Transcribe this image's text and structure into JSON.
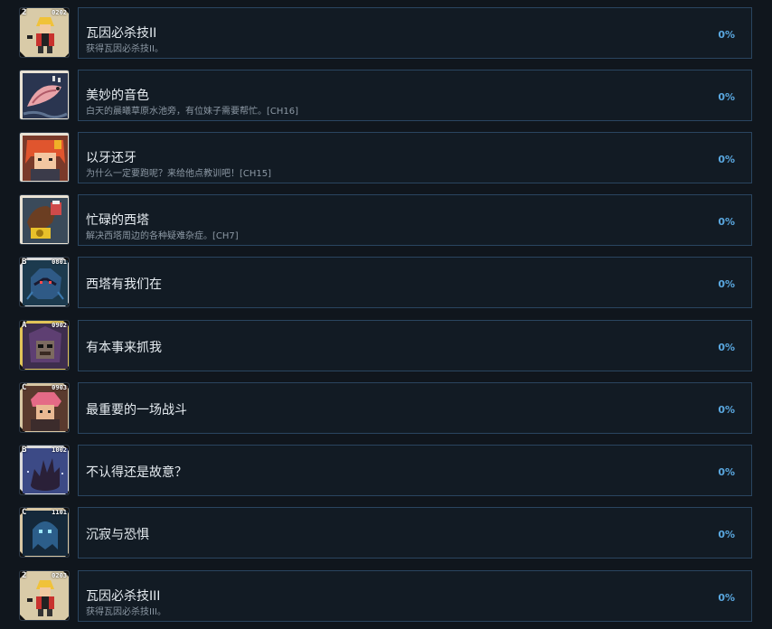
{
  "achievements": [
    {
      "title": "瓦因必杀技II",
      "desc": "获得瓦因必杀技II。",
      "pct": "0%",
      "icon": "hero-blonde-fighter-icon",
      "badge": "2",
      "code": "0202"
    },
    {
      "title": "美妙的音色",
      "desc": "白天的晨曦草原水池旁，有位妹子需要帮忙。[CH16]",
      "pct": "0%",
      "icon": "pink-fish-icon",
      "badge": "",
      "code": ""
    },
    {
      "title": "以牙还牙",
      "desc": "为什么一定要跑呢？来给他点教训吧！[CH15]",
      "pct": "0%",
      "icon": "red-hair-girl-icon",
      "badge": "",
      "code": ""
    },
    {
      "title": "忙碌的西塔",
      "desc": "解决西塔周边的各种疑难杂症。[CH7]",
      "pct": "0%",
      "icon": "hand-holding-bottle-icon",
      "badge": "",
      "code": ""
    },
    {
      "title": "西塔有我们在",
      "desc": "",
      "pct": "0%",
      "icon": "blue-beast-icon",
      "badge": "B",
      "code": "0801"
    },
    {
      "title": "有本事来抓我",
      "desc": "",
      "pct": "0%",
      "icon": "purple-hooded-face-icon",
      "badge": "A",
      "code": "0902"
    },
    {
      "title": "最重要的一场战斗",
      "desc": "",
      "pct": "0%",
      "icon": "pink-hair-boy-icon",
      "badge": "C",
      "code": "0903"
    },
    {
      "title": "不认得还是故意？",
      "desc": "",
      "pct": "0%",
      "icon": "dark-spiky-creature-icon",
      "badge": "B",
      "code": "1002"
    },
    {
      "title": "沉寂与恐惧",
      "desc": "",
      "pct": "0%",
      "icon": "blue-ghost-icon",
      "badge": "C",
      "code": "1101"
    },
    {
      "title": "瓦因必杀技III",
      "desc": "获得瓦因必杀技III。",
      "pct": "0%",
      "icon": "hero-blonde-fighter-icon",
      "badge": "2",
      "code": "0203"
    }
  ]
}
